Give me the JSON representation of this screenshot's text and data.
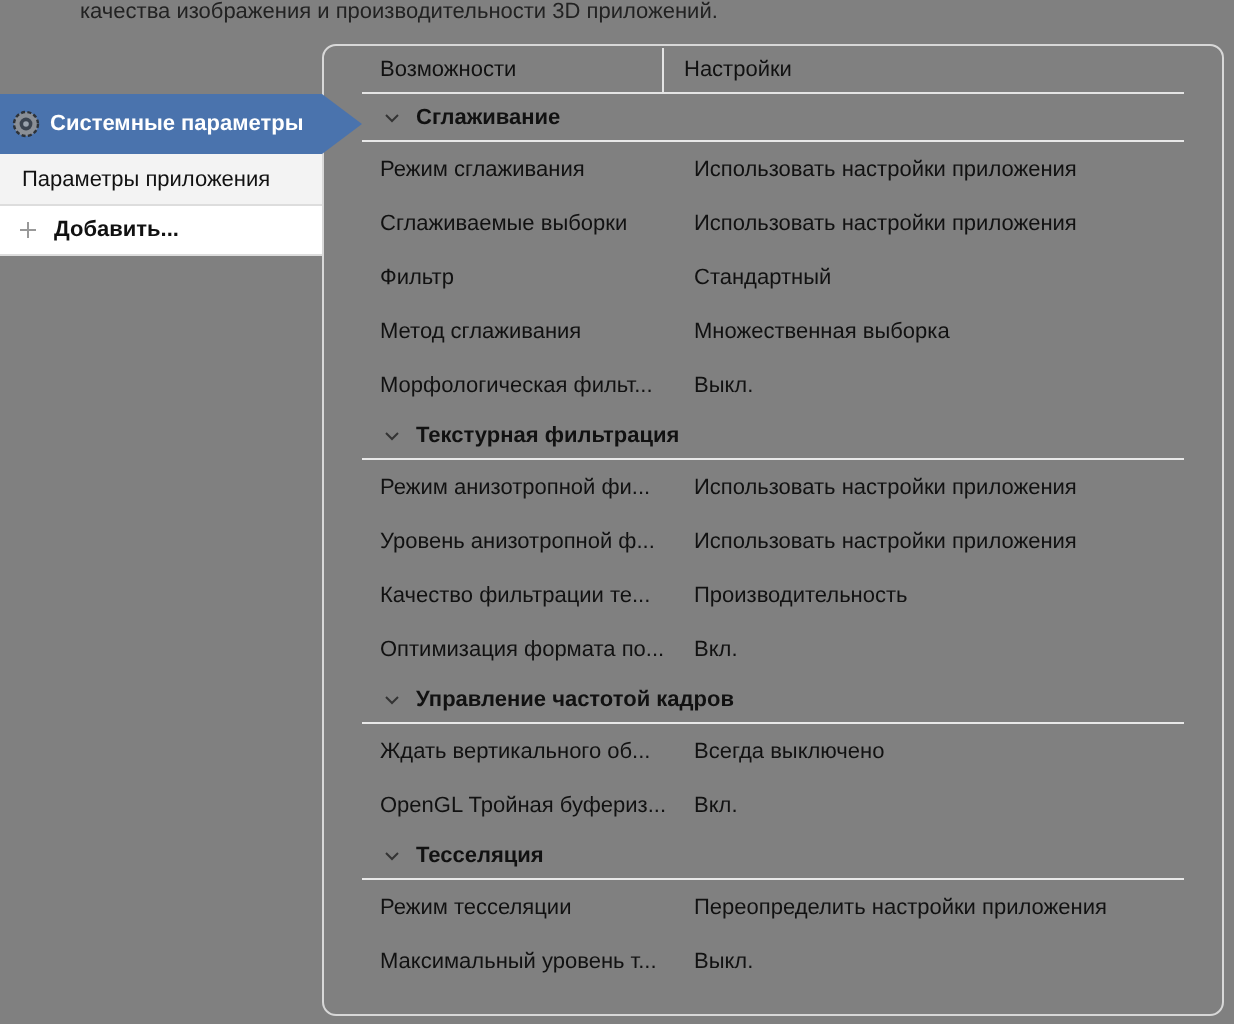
{
  "intro_text": "качества изображения и производительности 3D приложений.",
  "sidebar": {
    "items": [
      {
        "label": "Системные параметры",
        "kind": "profile",
        "selected": true
      },
      {
        "label": "Параметры приложения",
        "kind": "profile",
        "selected": false
      },
      {
        "label": "Добавить...",
        "kind": "add",
        "selected": false
      }
    ]
  },
  "table": {
    "columns": [
      "Возможности",
      "Настройки"
    ],
    "sections": [
      {
        "title": "Сглаживание",
        "expanded": true,
        "rows": [
          {
            "feature": "Режим сглаживания",
            "setting": "Использовать настройки приложения"
          },
          {
            "feature": "Сглаживаемые выборки",
            "setting": "Использовать настройки приложения"
          },
          {
            "feature": "Фильтр",
            "setting": "Стандартный"
          },
          {
            "feature": "Метод сглаживания",
            "setting": "Множественная выборка"
          },
          {
            "feature": "Морфологическая фильт...",
            "setting": "Выкл."
          }
        ]
      },
      {
        "title": "Текстурная фильтрация",
        "expanded": true,
        "rows": [
          {
            "feature": "Режим анизотропной фи...",
            "setting": "Использовать настройки приложения"
          },
          {
            "feature": "Уровень анизотропной ф...",
            "setting": "Использовать настройки приложения"
          },
          {
            "feature": "Качество фильтрации те...",
            "setting": "Производительность"
          },
          {
            "feature": "Оптимизация формата по...",
            "setting": "Вкл."
          }
        ]
      },
      {
        "title": "Управление частотой кадров",
        "expanded": true,
        "rows": [
          {
            "feature": "Ждать вертикального об...",
            "setting": "Всегда выключено"
          },
          {
            "feature": "OpenGL Тройная буфериз...",
            "setting": "Вкл."
          }
        ]
      },
      {
        "title": "Тесселяция",
        "expanded": true,
        "rows": [
          {
            "feature": "Режим тесселяции",
            "setting": "Переопределить настройки приложения"
          },
          {
            "feature": "Максимальный уровень т...",
            "setting": "Выкл."
          }
        ]
      }
    ]
  }
}
